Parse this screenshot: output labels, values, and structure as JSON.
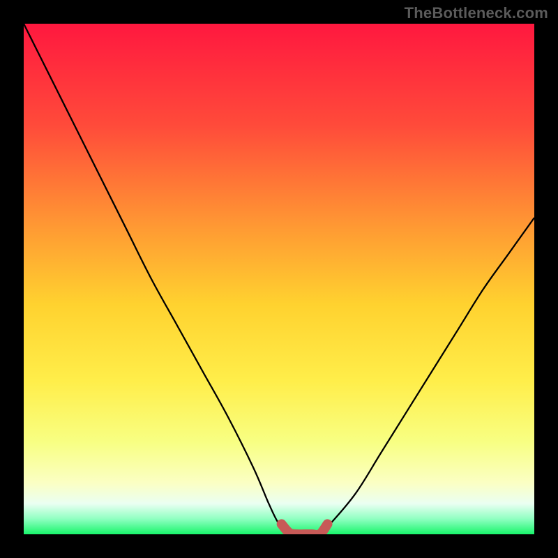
{
  "watermark": "TheBottleneck.com",
  "chart_data": {
    "type": "line",
    "title": "",
    "xlabel": "",
    "ylabel": "",
    "xlim": [
      0,
      100
    ],
    "ylim": [
      0,
      100
    ],
    "series": [
      {
        "name": "bottleneck-curve",
        "x": [
          0,
          5,
          10,
          15,
          20,
          25,
          30,
          35,
          40,
          45,
          48,
          50,
          52,
          55,
          58,
          60,
          65,
          70,
          75,
          80,
          85,
          90,
          95,
          100
        ],
        "y": [
          100,
          90,
          80,
          70,
          60,
          50,
          41,
          32,
          23,
          13,
          6,
          2,
          0,
          0,
          0,
          2,
          8,
          16,
          24,
          32,
          40,
          48,
          55,
          62
        ]
      },
      {
        "name": "valley-highlight",
        "x": [
          50.5,
          52,
          53.5,
          55,
          56.5,
          58,
          59.5
        ],
        "y": [
          2.0,
          0.3,
          0.0,
          0.0,
          0.0,
          0.0,
          2.0
        ]
      }
    ],
    "gradient_stops": [
      {
        "offset": 0,
        "color": "#ff183f"
      },
      {
        "offset": 20,
        "color": "#ff4b3a"
      },
      {
        "offset": 40,
        "color": "#ff9a33"
      },
      {
        "offset": 55,
        "color": "#ffd22f"
      },
      {
        "offset": 70,
        "color": "#ffee4a"
      },
      {
        "offset": 82,
        "color": "#f8ff83"
      },
      {
        "offset": 90,
        "color": "#fbffc4"
      },
      {
        "offset": 94,
        "color": "#eafff2"
      },
      {
        "offset": 97,
        "color": "#8fffc1"
      },
      {
        "offset": 100,
        "color": "#18f56b"
      }
    ]
  }
}
